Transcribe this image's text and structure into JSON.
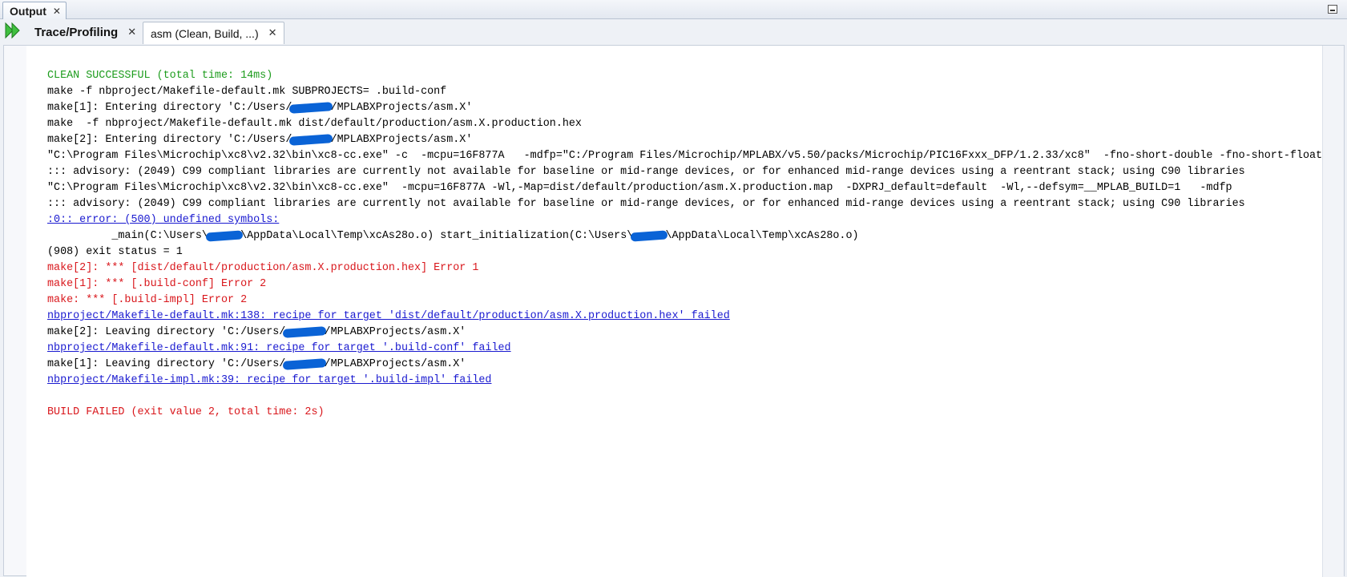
{
  "window": {
    "title": "Output"
  },
  "tabs": [
    {
      "label": "Trace/Profiling"
    },
    {
      "label": "asm (Clean, Build, ...)"
    }
  ],
  "log": [
    {
      "style": "green",
      "text": "CLEAN SUCCESSFUL (total time: 14ms)"
    },
    {
      "style": "plain",
      "text": "make -f nbproject/Makefile-default.mk SUBPROJECTS= .build-conf"
    },
    {
      "style": "plain",
      "pre": "make[1]: Entering directory 'C:/Users/",
      "redacted": "      ",
      "post": "/MPLABXProjects/asm.X'"
    },
    {
      "style": "plain",
      "text": "make  -f nbproject/Makefile-default.mk dist/default/production/asm.X.production.hex"
    },
    {
      "style": "plain",
      "pre": "make[2]: Entering directory 'C:/Users/",
      "redacted": "      ",
      "post": "/MPLABXProjects/asm.X'"
    },
    {
      "style": "plain",
      "text": "\"C:\\Program Files\\Microchip\\xc8\\v2.32\\bin\\xc8-cc.exe\" -c  -mcpu=16F877A   -mdfp=\"C:/Program Files/Microchip/MPLABX/v5.50/packs/Microchip/PIC16Fxxx_DFP/1.2.33/xc8\"  -fno-short-double -fno-short-float"
    },
    {
      "style": "plain",
      "text": "::: advisory: (2049) C99 compliant libraries are currently not available for baseline or mid-range devices, or for enhanced mid-range devices using a reentrant stack; using C90 libraries"
    },
    {
      "style": "plain",
      "text": "\"C:\\Program Files\\Microchip\\xc8\\v2.32\\bin\\xc8-cc.exe\"  -mcpu=16F877A -Wl,-Map=dist/default/production/asm.X.production.map  -DXPRJ_default=default  -Wl,--defsym=__MPLAB_BUILD=1   -mdfp"
    },
    {
      "style": "plain",
      "text": "::: advisory: (2049) C99 compliant libraries are currently not available for baseline or mid-range devices, or for enhanced mid-range devices using a reentrant stack; using C90 libraries"
    },
    {
      "style": "link",
      "text": ":0:: error: (500) undefined symbols:"
    },
    {
      "style": "plain",
      "pre": "          _main(C:\\Users\\",
      "redacted": "     ",
      "post": "\\AppData\\Local\\Temp\\xcAs28o.o) start_initialization(C:\\Users\\",
      "redacted2": "     ",
      "post2": "\\AppData\\Local\\Temp\\xcAs28o.o)"
    },
    {
      "style": "plain",
      "text": "(908) exit status = 1"
    },
    {
      "style": "red",
      "text": "make[2]: *** [dist/default/production/asm.X.production.hex] Error 1"
    },
    {
      "style": "red",
      "text": "make[1]: *** [.build-conf] Error 2"
    },
    {
      "style": "red",
      "text": "make: *** [.build-impl] Error 2"
    },
    {
      "style": "link",
      "text": "nbproject/Makefile-default.mk:138: recipe for target 'dist/default/production/asm.X.production.hex' failed"
    },
    {
      "style": "plain",
      "pre": "make[2]: Leaving directory 'C:/Users/",
      "redacted": "      ",
      "post": "/MPLABXProjects/asm.X'"
    },
    {
      "style": "link",
      "text": "nbproject/Makefile-default.mk:91: recipe for target '.build-conf' failed"
    },
    {
      "style": "plain",
      "pre": "make[1]: Leaving directory 'C:/Users/",
      "redacted": "      ",
      "post": "/MPLABXProjects/asm.X'"
    },
    {
      "style": "link",
      "text": "nbproject/Makefile-impl.mk:39: recipe for target '.build-impl' failed"
    },
    {
      "style": "plain",
      "text": ""
    },
    {
      "style": "red",
      "text": "BUILD FAILED (exit value 2, total time: 2s)"
    }
  ]
}
